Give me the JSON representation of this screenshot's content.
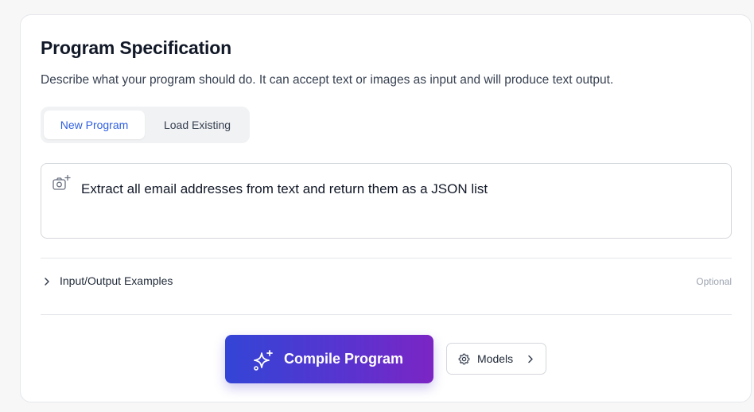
{
  "card": {
    "title": "Program Specification",
    "subtitle": "Describe what your program should do. It can accept text or images as input and will produce text output."
  },
  "tabs": [
    {
      "label": "New Program",
      "active": true
    },
    {
      "label": "Load Existing",
      "active": false
    }
  ],
  "prompt": {
    "value": "Extract all email addresses from text and return them as a JSON list",
    "attach_icon": "camera-plus-icon"
  },
  "examples": {
    "label": "Input/Output Examples",
    "optional_label": "Optional",
    "expanded": false
  },
  "actions": {
    "compile_label": "Compile Program",
    "compile_icon": "sparkles-icon",
    "models_label": "Models",
    "models_icon": "gear-icon"
  },
  "colors": {
    "accent": "#2f5fe0",
    "gradient_start": "#3345d6",
    "gradient_end": "#7b25c4"
  }
}
